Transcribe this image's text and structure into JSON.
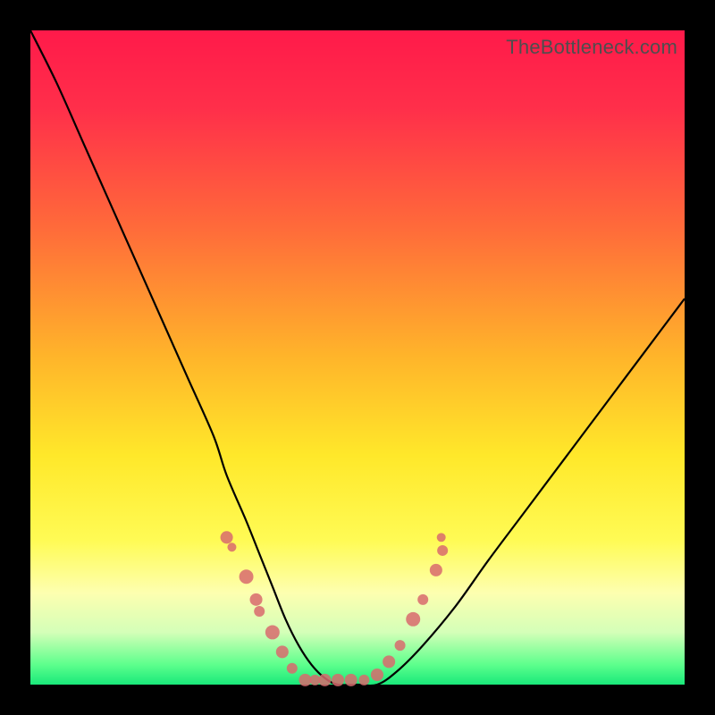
{
  "watermark": "TheBottleneck.com",
  "colors": {
    "gradient_stops": [
      {
        "offset": 0.0,
        "color": "#ff1a4a"
      },
      {
        "offset": 0.12,
        "color": "#ff2f4a"
      },
      {
        "offset": 0.3,
        "color": "#ff6a3a"
      },
      {
        "offset": 0.5,
        "color": "#ffb52a"
      },
      {
        "offset": 0.65,
        "color": "#ffe82a"
      },
      {
        "offset": 0.78,
        "color": "#fffb55"
      },
      {
        "offset": 0.86,
        "color": "#fdffb0"
      },
      {
        "offset": 0.92,
        "color": "#d4ffb8"
      },
      {
        "offset": 0.97,
        "color": "#5cff8c"
      },
      {
        "offset": 1.0,
        "color": "#19e87a"
      }
    ],
    "curve": "#000000",
    "dot": "#d86a6d",
    "frame": "#000000"
  },
  "chart_data": {
    "type": "line",
    "title": "",
    "xlabel": "",
    "ylabel": "",
    "xlim": [
      0,
      100
    ],
    "ylim": [
      0,
      100
    ],
    "x": [
      0,
      4,
      8,
      12,
      16,
      20,
      24,
      28,
      30,
      33,
      35,
      37,
      39,
      41,
      43,
      45,
      47,
      50,
      53,
      56,
      60,
      65,
      70,
      76,
      82,
      88,
      94,
      100
    ],
    "values": [
      100,
      92,
      83,
      74,
      65,
      56,
      47,
      38,
      32,
      25,
      20,
      15,
      10,
      6,
      3,
      1,
      0,
      0,
      0,
      2,
      6,
      12,
      19,
      27,
      35,
      43,
      51,
      59
    ],
    "note": "x and values are percent of plot width/height; y increases downward visually means lower value is lower on chart. values[] here encode the curve's vertical distance from the top edge mapped to 0..100 so that 100 is top and 0 is bottom.",
    "markers": {
      "comment": "Scatter dot cluster positions in percent coordinates (x%, y% from top-left).",
      "points": [
        {
          "x": 30.0,
          "y": 77.5,
          "r": 7
        },
        {
          "x": 30.8,
          "y": 79.0,
          "r": 5
        },
        {
          "x": 33.0,
          "y": 83.5,
          "r": 8
        },
        {
          "x": 34.5,
          "y": 87.0,
          "r": 7
        },
        {
          "x": 35.0,
          "y": 88.8,
          "r": 6
        },
        {
          "x": 37.0,
          "y": 92.0,
          "r": 8
        },
        {
          "x": 38.5,
          "y": 95.0,
          "r": 7
        },
        {
          "x": 40.0,
          "y": 97.5,
          "r": 6
        },
        {
          "x": 42.0,
          "y": 99.3,
          "r": 7
        },
        {
          "x": 43.5,
          "y": 99.3,
          "r": 6
        },
        {
          "x": 45.0,
          "y": 99.3,
          "r": 7
        },
        {
          "x": 47.0,
          "y": 99.3,
          "r": 7
        },
        {
          "x": 49.0,
          "y": 99.3,
          "r": 7
        },
        {
          "x": 51.0,
          "y": 99.3,
          "r": 6
        },
        {
          "x": 53.0,
          "y": 98.5,
          "r": 7
        },
        {
          "x": 54.8,
          "y": 96.5,
          "r": 7
        },
        {
          "x": 56.5,
          "y": 94.0,
          "r": 6
        },
        {
          "x": 58.5,
          "y": 90.0,
          "r": 8
        },
        {
          "x": 60.0,
          "y": 87.0,
          "r": 6
        },
        {
          "x": 62.0,
          "y": 82.5,
          "r": 7
        },
        {
          "x": 63.0,
          "y": 79.5,
          "r": 6
        },
        {
          "x": 62.8,
          "y": 77.5,
          "r": 5
        }
      ]
    }
  }
}
